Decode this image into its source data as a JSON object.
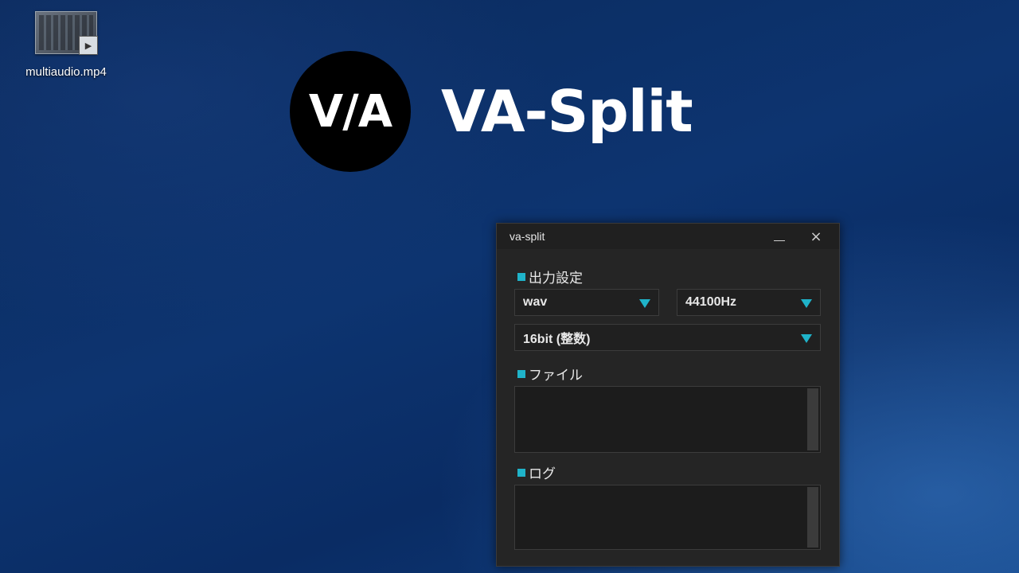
{
  "desktop": {
    "icon_label": "multiaudio.mp4",
    "icon_name": "video-file-icon"
  },
  "logo": {
    "mark": "V/A",
    "name": "VA-Split"
  },
  "window": {
    "title": "va-split",
    "minimize_icon": "minimize-icon",
    "close_icon": "×",
    "output": {
      "heading": "出力設定",
      "format": "wav",
      "sample_rate": "44100Hz",
      "bit_depth": "16bit (整数)"
    },
    "files": {
      "heading": "ファイル"
    },
    "log": {
      "heading": "ログ"
    },
    "accent_color": "#1fb3c9"
  }
}
